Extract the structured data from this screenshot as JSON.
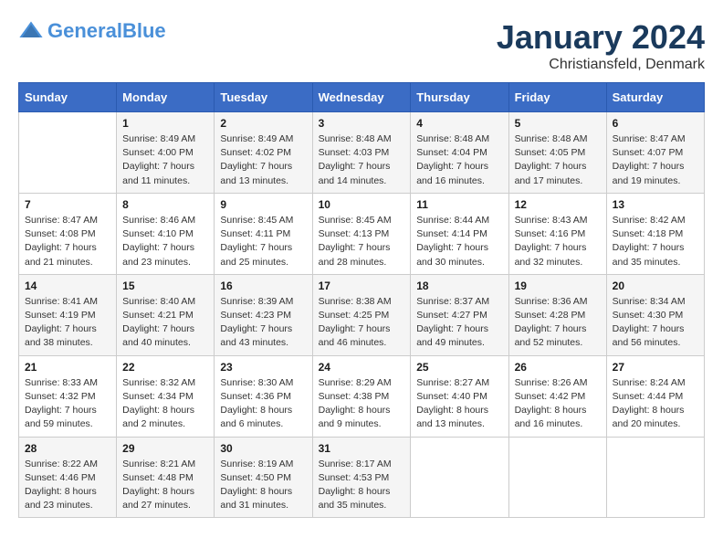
{
  "header": {
    "logo_line1": "General",
    "logo_line2": "Blue",
    "month": "January 2024",
    "location": "Christiansfeld, Denmark"
  },
  "weekdays": [
    "Sunday",
    "Monday",
    "Tuesday",
    "Wednesday",
    "Thursday",
    "Friday",
    "Saturday"
  ],
  "weeks": [
    [
      {
        "day": "",
        "info": ""
      },
      {
        "day": "1",
        "info": "Sunrise: 8:49 AM\nSunset: 4:00 PM\nDaylight: 7 hours\nand 11 minutes."
      },
      {
        "day": "2",
        "info": "Sunrise: 8:49 AM\nSunset: 4:02 PM\nDaylight: 7 hours\nand 13 minutes."
      },
      {
        "day": "3",
        "info": "Sunrise: 8:48 AM\nSunset: 4:03 PM\nDaylight: 7 hours\nand 14 minutes."
      },
      {
        "day": "4",
        "info": "Sunrise: 8:48 AM\nSunset: 4:04 PM\nDaylight: 7 hours\nand 16 minutes."
      },
      {
        "day": "5",
        "info": "Sunrise: 8:48 AM\nSunset: 4:05 PM\nDaylight: 7 hours\nand 17 minutes."
      },
      {
        "day": "6",
        "info": "Sunrise: 8:47 AM\nSunset: 4:07 PM\nDaylight: 7 hours\nand 19 minutes."
      }
    ],
    [
      {
        "day": "7",
        "info": "Sunrise: 8:47 AM\nSunset: 4:08 PM\nDaylight: 7 hours\nand 21 minutes."
      },
      {
        "day": "8",
        "info": "Sunrise: 8:46 AM\nSunset: 4:10 PM\nDaylight: 7 hours\nand 23 minutes."
      },
      {
        "day": "9",
        "info": "Sunrise: 8:45 AM\nSunset: 4:11 PM\nDaylight: 7 hours\nand 25 minutes."
      },
      {
        "day": "10",
        "info": "Sunrise: 8:45 AM\nSunset: 4:13 PM\nDaylight: 7 hours\nand 28 minutes."
      },
      {
        "day": "11",
        "info": "Sunrise: 8:44 AM\nSunset: 4:14 PM\nDaylight: 7 hours\nand 30 minutes."
      },
      {
        "day": "12",
        "info": "Sunrise: 8:43 AM\nSunset: 4:16 PM\nDaylight: 7 hours\nand 32 minutes."
      },
      {
        "day": "13",
        "info": "Sunrise: 8:42 AM\nSunset: 4:18 PM\nDaylight: 7 hours\nand 35 minutes."
      }
    ],
    [
      {
        "day": "14",
        "info": "Sunrise: 8:41 AM\nSunset: 4:19 PM\nDaylight: 7 hours\nand 38 minutes."
      },
      {
        "day": "15",
        "info": "Sunrise: 8:40 AM\nSunset: 4:21 PM\nDaylight: 7 hours\nand 40 minutes."
      },
      {
        "day": "16",
        "info": "Sunrise: 8:39 AM\nSunset: 4:23 PM\nDaylight: 7 hours\nand 43 minutes."
      },
      {
        "day": "17",
        "info": "Sunrise: 8:38 AM\nSunset: 4:25 PM\nDaylight: 7 hours\nand 46 minutes."
      },
      {
        "day": "18",
        "info": "Sunrise: 8:37 AM\nSunset: 4:27 PM\nDaylight: 7 hours\nand 49 minutes."
      },
      {
        "day": "19",
        "info": "Sunrise: 8:36 AM\nSunset: 4:28 PM\nDaylight: 7 hours\nand 52 minutes."
      },
      {
        "day": "20",
        "info": "Sunrise: 8:34 AM\nSunset: 4:30 PM\nDaylight: 7 hours\nand 56 minutes."
      }
    ],
    [
      {
        "day": "21",
        "info": "Sunrise: 8:33 AM\nSunset: 4:32 PM\nDaylight: 7 hours\nand 59 minutes."
      },
      {
        "day": "22",
        "info": "Sunrise: 8:32 AM\nSunset: 4:34 PM\nDaylight: 8 hours\nand 2 minutes."
      },
      {
        "day": "23",
        "info": "Sunrise: 8:30 AM\nSunset: 4:36 PM\nDaylight: 8 hours\nand 6 minutes."
      },
      {
        "day": "24",
        "info": "Sunrise: 8:29 AM\nSunset: 4:38 PM\nDaylight: 8 hours\nand 9 minutes."
      },
      {
        "day": "25",
        "info": "Sunrise: 8:27 AM\nSunset: 4:40 PM\nDaylight: 8 hours\nand 13 minutes."
      },
      {
        "day": "26",
        "info": "Sunrise: 8:26 AM\nSunset: 4:42 PM\nDaylight: 8 hours\nand 16 minutes."
      },
      {
        "day": "27",
        "info": "Sunrise: 8:24 AM\nSunset: 4:44 PM\nDaylight: 8 hours\nand 20 minutes."
      }
    ],
    [
      {
        "day": "28",
        "info": "Sunrise: 8:22 AM\nSunset: 4:46 PM\nDaylight: 8 hours\nand 23 minutes."
      },
      {
        "day": "29",
        "info": "Sunrise: 8:21 AM\nSunset: 4:48 PM\nDaylight: 8 hours\nand 27 minutes."
      },
      {
        "day": "30",
        "info": "Sunrise: 8:19 AM\nSunset: 4:50 PM\nDaylight: 8 hours\nand 31 minutes."
      },
      {
        "day": "31",
        "info": "Sunrise: 8:17 AM\nSunset: 4:53 PM\nDaylight: 8 hours\nand 35 minutes."
      },
      {
        "day": "",
        "info": ""
      },
      {
        "day": "",
        "info": ""
      },
      {
        "day": "",
        "info": ""
      }
    ]
  ]
}
